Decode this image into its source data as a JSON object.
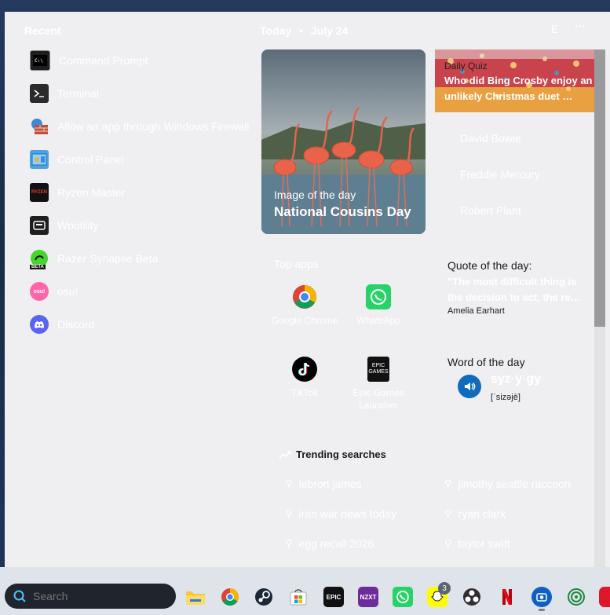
{
  "recent": {
    "title": "Recent",
    "items": [
      {
        "label": "Command Prompt",
        "icon": "command-prompt-icon"
      },
      {
        "label": "Terminal",
        "icon": "terminal-icon"
      },
      {
        "label": "Allow an app through Windows Firewall",
        "icon": "firewall-icon"
      },
      {
        "label": "Control Panel",
        "icon": "control-panel-icon"
      },
      {
        "label": "Ryzen Master",
        "icon": "ryzen-master-icon",
        "badge": "RYZEN"
      },
      {
        "label": "Wootility",
        "icon": "wootility-icon"
      },
      {
        "label": "Razer Synapse Beta",
        "icon": "razer-synapse-icon",
        "badge": "BETA"
      },
      {
        "label": "osu!",
        "icon": "osu-icon",
        "badge": "osu!"
      },
      {
        "label": "Discord",
        "icon": "discord-icon"
      }
    ]
  },
  "header": {
    "today": "Today",
    "separator": "•",
    "date": "July 24",
    "avatar_letter": "E",
    "more": "···"
  },
  "image_of_day": {
    "label": "Image of the day",
    "title": "National Cousins Day"
  },
  "quiz": {
    "label": "Daily Quiz",
    "question": "Who did Bing Crosby enjoy an unlikely Christmas duet …",
    "answers": [
      "David Bowie",
      "Freddie Mercury",
      "Robert Plant"
    ]
  },
  "top_apps": {
    "title": "Top apps",
    "apps": [
      {
        "label": "Google Chrome",
        "icon": "chrome-icon"
      },
      {
        "label": "WhatsApp",
        "icon": "whatsapp-icon"
      },
      {
        "label": "TikTok",
        "icon": "tiktok-icon"
      },
      {
        "label": "Epic Games Launcher",
        "icon": "epic-games-icon",
        "badge": "EPIC GAMES"
      }
    ]
  },
  "quote": {
    "title": "Quote of the day:",
    "text": "\"The most difficult thing is the decision to act, the re…",
    "author": "Amelia Earhart"
  },
  "word": {
    "title": "Word of the day",
    "word": "syz·y·gy",
    "pronunciation": "[ˈsizəjē]"
  },
  "trending": {
    "title": "Trending searches",
    "items": [
      "lebron james",
      "jimothy seattle raccoon",
      "iran war news today",
      "ryan clark",
      "egg recall 2026",
      "taylor swift"
    ]
  },
  "taskbar": {
    "search_placeholder": "Search",
    "snapchat_badge": "3",
    "epic_badge": "EPIC",
    "nzxt_badge": "NZXT",
    "icons": [
      "file-explorer-icon",
      "chrome-icon",
      "steam-icon",
      "microsoft-store-icon",
      "epic-games-icon",
      "nzxt-icon",
      "whatsapp-icon",
      "snapchat-icon",
      "obs-icon",
      "netflix-icon",
      "capture-icon",
      "app-icon",
      "app-red-icon"
    ]
  },
  "colors": {
    "accent": "#0f6cbd",
    "panel": "#efeff1",
    "taskbar": "#dfe3ea"
  }
}
